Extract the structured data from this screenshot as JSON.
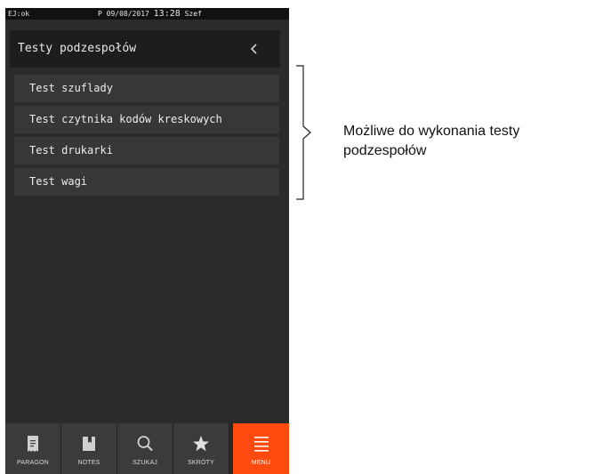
{
  "status_bar": {
    "left": "EJ:ok",
    "prefix": "P",
    "date": "09/08/2017",
    "time": "13:28",
    "user": "Szef"
  },
  "header": {
    "title": "Testy podzespołów",
    "back_icon": "chevron-left-icon"
  },
  "menu": {
    "items": [
      {
        "label": "Test szuflady"
      },
      {
        "label": "Test czytnika kodów kreskowych"
      },
      {
        "label": "Test drukarki"
      },
      {
        "label": "Test wagi"
      }
    ]
  },
  "nav": {
    "active_color": "#ff4a10",
    "items": [
      {
        "label": "PARAGON",
        "icon": "receipt-icon"
      },
      {
        "label": "NOTES",
        "icon": "notebook-icon"
      },
      {
        "label": "SZUKAJ",
        "icon": "search-icon"
      },
      {
        "label": "SKRÓTY",
        "icon": "star-icon"
      },
      {
        "label": "MENU",
        "icon": "menu-icon",
        "active": true
      }
    ]
  },
  "annotation": {
    "line1": "Możliwe do wykonania testy",
    "line2": "podzespołów"
  }
}
